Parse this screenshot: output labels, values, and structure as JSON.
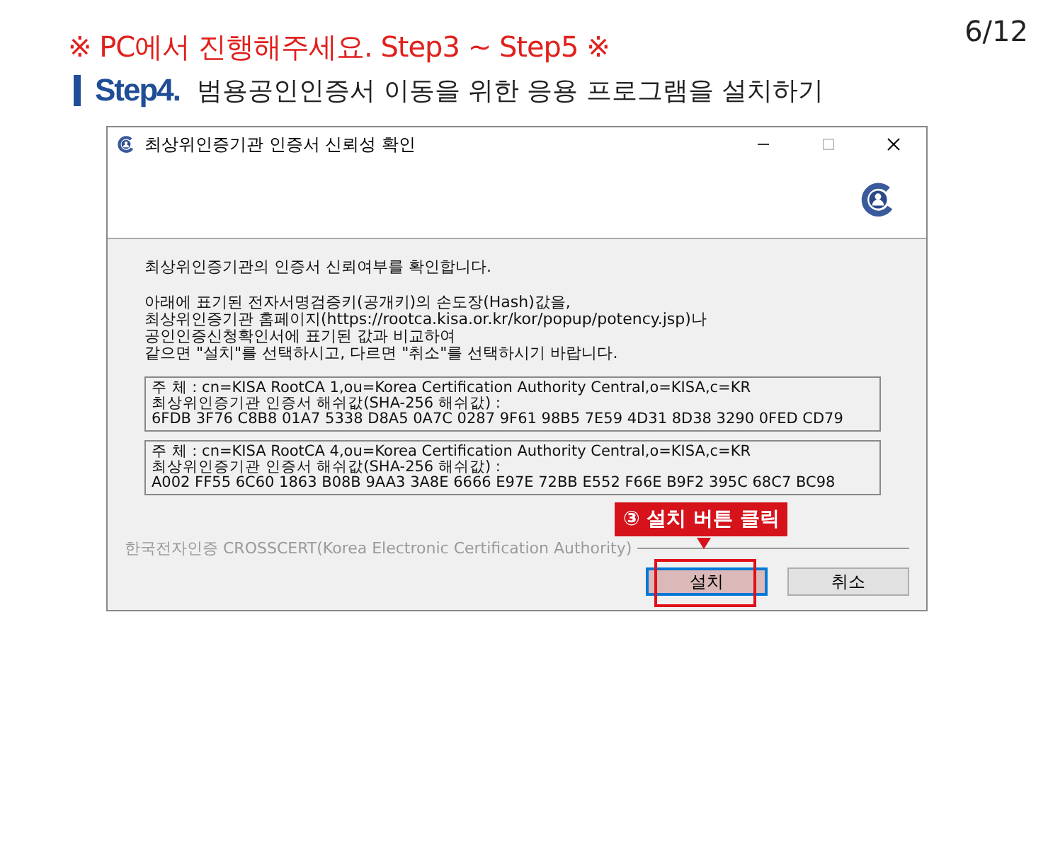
{
  "notice": "※ PC에서 진행해주세요. Step3 ~ Step5 ※",
  "page_number": "6/12",
  "step": {
    "label": "Step4.",
    "title": "범용공인인증서 이동을 위한 응용 프로그램을 설치하기"
  },
  "window": {
    "title": "최상위인증기관 인증서 신뢰성 확인"
  },
  "intro": "최상위인증기관의 인증서 신뢰여부를 확인합니다.",
  "instructions": [
    "아래에 표기된 전자서명검증키(공개키)의 손도장(Hash)값을,",
    "최상위인증기관 홈페이지(https://rootca.kisa.or.kr/kor/popup/potency.jsp)나",
    "공인인증신청확인서에 표기된 값과 비교하여",
    "같으면 \"설치\"를 선택하시고, 다르면 \"취소\"를 선택하시기 바랍니다."
  ],
  "certificates": [
    {
      "lines": [
        "주  체 : cn=KISA RootCA 1,ou=Korea Certification Authority Central,o=KISA,c=KR",
        "최상위인증기관 인증서 해쉬값(SHA-256 해쉬값) :",
        "6FDB 3F76 C8B8 01A7 5338 D8A5 0A7C 0287 9F61 98B5 7E59 4D31 8D38 3290 0FED CD79"
      ]
    },
    {
      "lines": [
        "주  체 : cn=KISA RootCA 4,ou=Korea Certification Authority Central,o=KISA,c=KR",
        "최상위인증기관 인증서 해쉬값(SHA-256 해쉬값) :",
        "A002 FF55 6C60 1863 B08B 9AA3 3A8E 6666 E97E 72BB E552 F66E B9F2 395C 68C7 BC98"
      ]
    }
  ],
  "footer": "한국전자인증 CROSSCERT(Korea Electronic Certification Authority)",
  "buttons": [
    {
      "label": "설치",
      "selected": true
    },
    {
      "label": "취소",
      "selected": false
    }
  ],
  "callout": {
    "label": "③ 설치 버튼 클릭"
  }
}
